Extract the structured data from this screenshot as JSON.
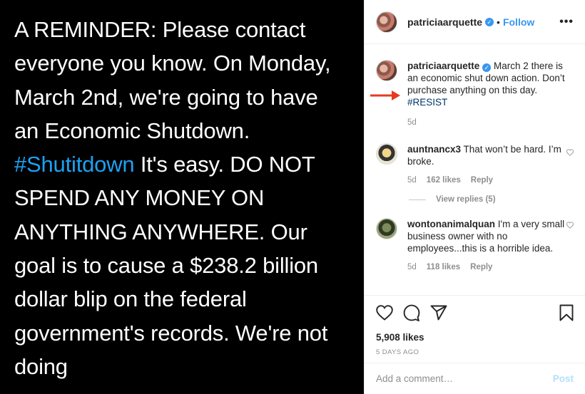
{
  "image_text": {
    "lines": [
      "A REMINDER: Please contact",
      "everyone you know. On Monday,",
      "March 2nd, we're going to have",
      "an Economic Shutdown."
    ],
    "hashtag": "#Shutitdown",
    "after_hashtag": " It's easy. DO NOT",
    "more_lines": [
      "SPEND ANY MONEY ON",
      "ANYTHING ANYWHERE. Our",
      "goal is to cause a $238.2 billion",
      "dollar blip on the federal",
      "government's records. We're not",
      "doing"
    ]
  },
  "header": {
    "username": "patriciaarquette",
    "verified_glyph": "✓",
    "dot": "•",
    "follow_label": "Follow",
    "more_glyph": "•••"
  },
  "caption": {
    "username": "patriciaarquette",
    "text": " March 2 there is an economic shut down action. Don’t purchase anything on this day.",
    "hashtag": "#RESIST",
    "time": "5d"
  },
  "comments": [
    {
      "username": "auntnancx3",
      "text": " That won’t be hard. I’m broke.",
      "time": "5d",
      "likes": "162 likes",
      "reply": "Reply",
      "view_replies": "View replies (5)"
    },
    {
      "username": "wontonanimalquan",
      "text": " I'm a very small business owner with no employees...this is a horrible idea.",
      "time": "5d",
      "likes": "118 likes",
      "reply": "Reply"
    }
  ],
  "post": {
    "likes": "5,908 likes",
    "date": "5 DAYS AGO"
  },
  "add_comment": {
    "placeholder": "Add a comment…",
    "post_label": "Post"
  },
  "colors": {
    "accent": "#3897f0",
    "tweet_hashtag": "#1da1f2",
    "annotation_arrow": "#e8391f"
  }
}
